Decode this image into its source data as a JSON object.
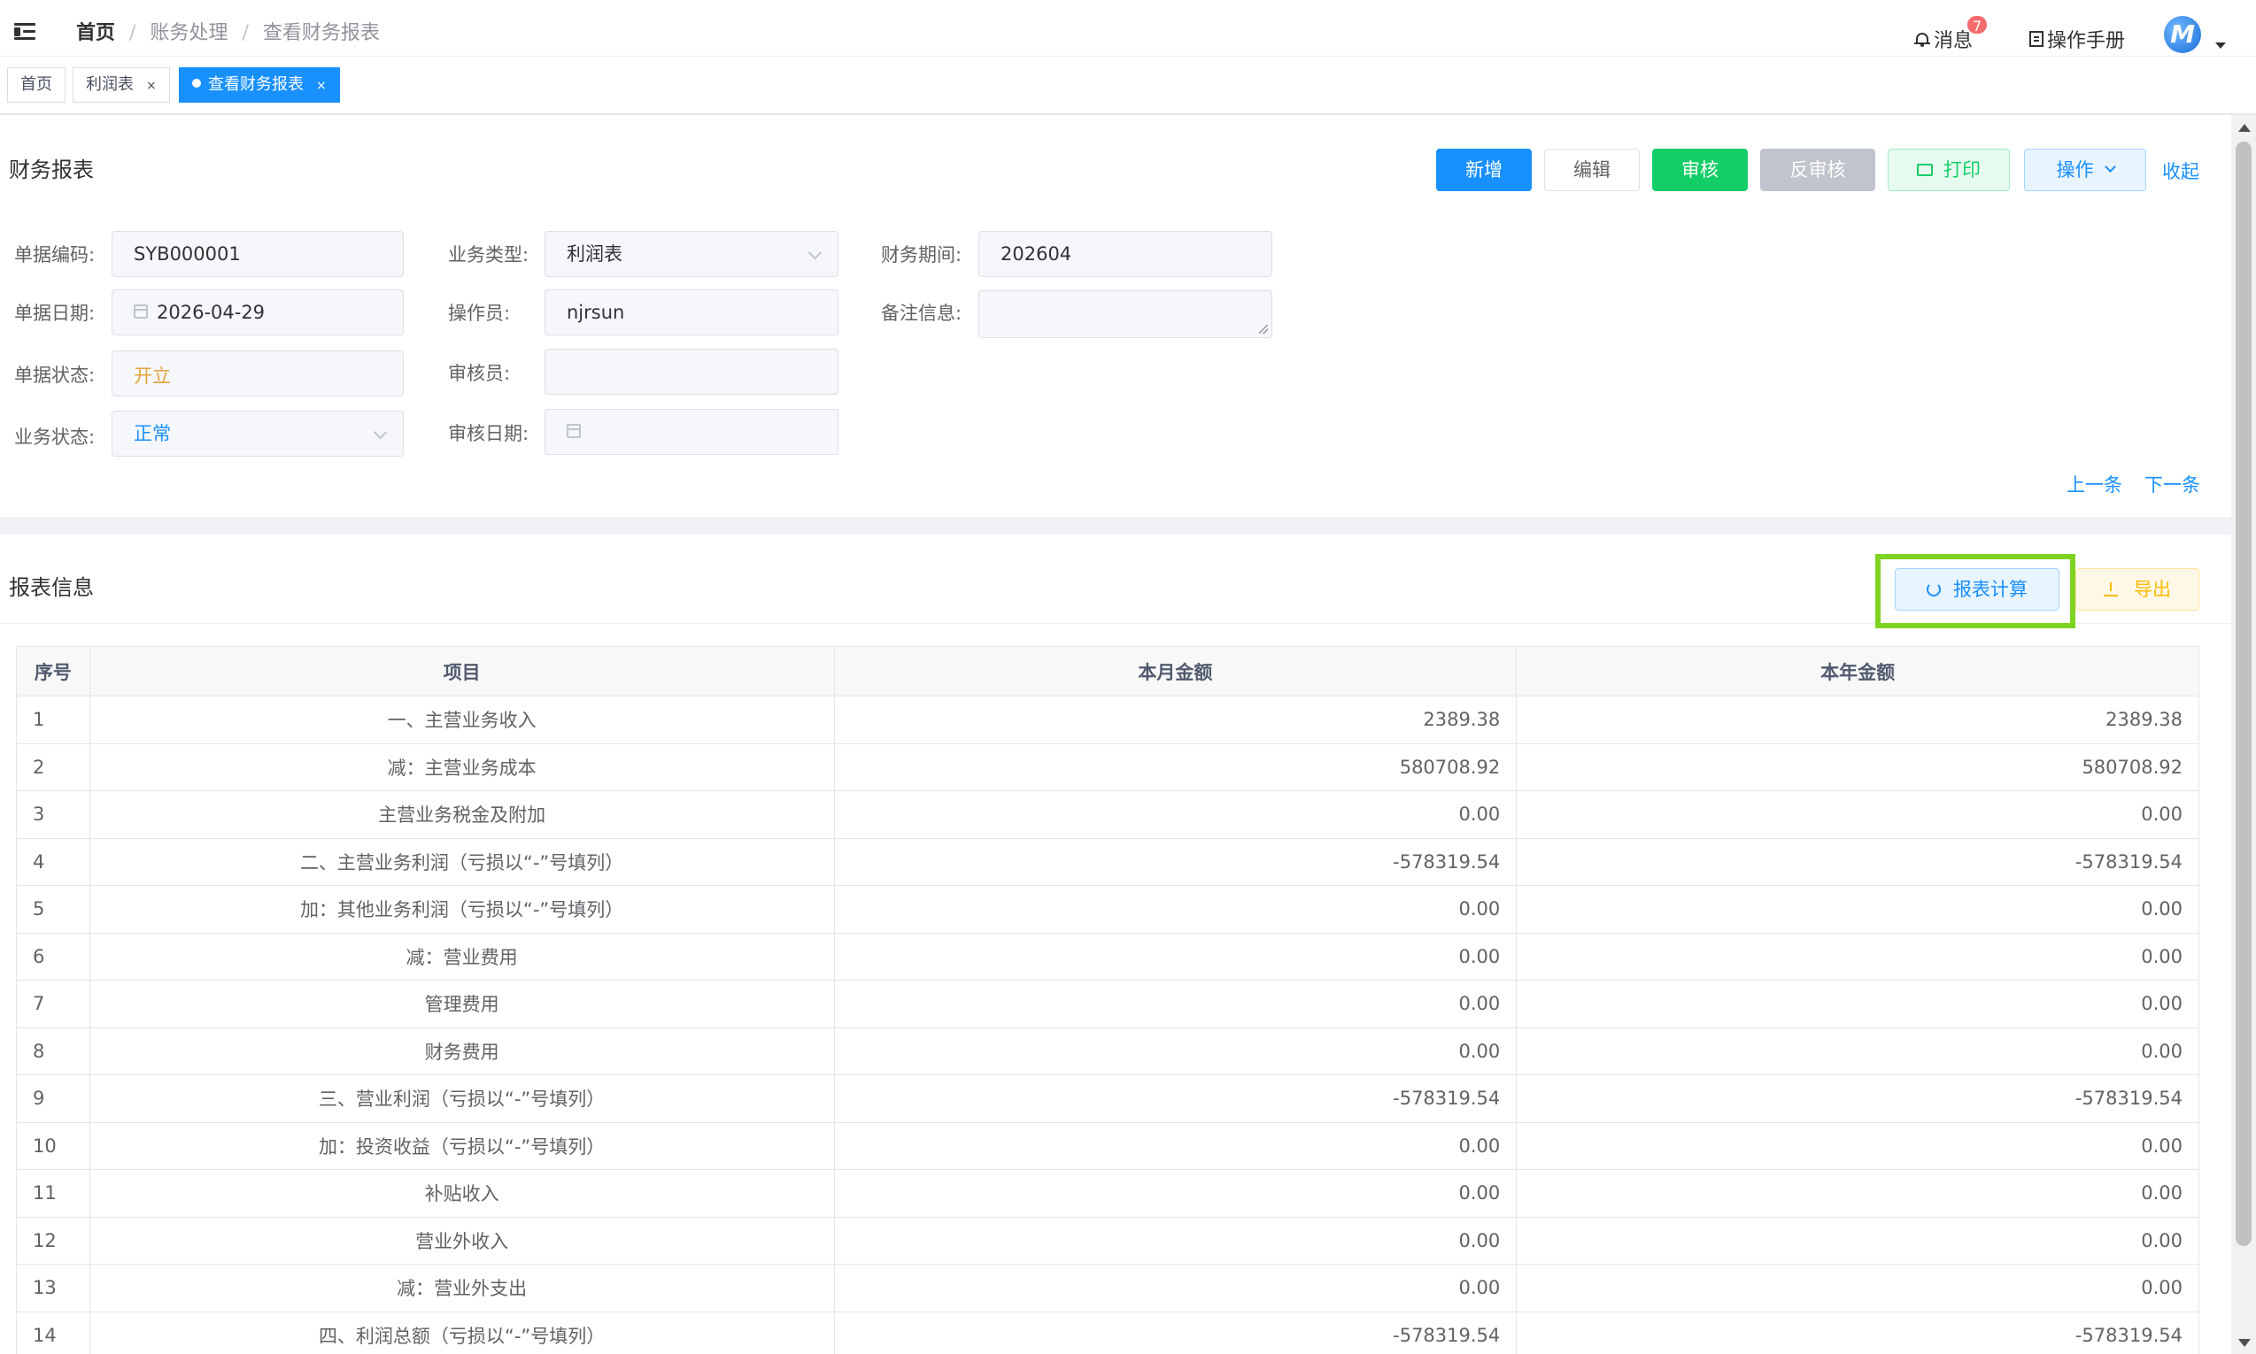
{
  "header": {
    "breadcrumb": [
      "首页",
      "账务处理",
      "查看财务报表"
    ],
    "breadcrumb_sep": "/",
    "messages_label": "消息",
    "messages_count": "7",
    "manual_label": "操作手册",
    "avatar_letter": "M"
  },
  "tags": [
    {
      "label": "首页",
      "close": ""
    },
    {
      "label": "利润表",
      "close": "×"
    },
    {
      "label": "查看财务报表",
      "close": "×"
    }
  ],
  "doc": {
    "title": "财务报表",
    "buttons": {
      "add": "新增",
      "edit": "编辑",
      "approve": "审核",
      "unapprove": "反审核",
      "print": "打印",
      "ops": "操作",
      "collapse": "收起"
    },
    "fields": {
      "bill_no": {
        "label": "单据编码:",
        "value": "SYB000001"
      },
      "biz_type": {
        "label": "业务类型:",
        "value": "利润表"
      },
      "period": {
        "label": "财务期间:",
        "value": "202604"
      },
      "bill_date": {
        "label": "单据日期:",
        "value": "2026-04-29"
      },
      "operator": {
        "label": "操作员:",
        "value": "njrsun"
      },
      "remark": {
        "label": "备注信息:",
        "value": ""
      },
      "bill_status": {
        "label": "单据状态:",
        "value": "开立"
      },
      "auditor": {
        "label": "审核员:",
        "value": ""
      },
      "biz_status": {
        "label": "业务状态:",
        "value": "正常"
      },
      "audit_date": {
        "label": "审核日期:",
        "value": ""
      }
    },
    "prev": "上一条",
    "next": "下一条"
  },
  "report": {
    "title": "报表信息",
    "calc_button": "报表计算",
    "export_button": "导出",
    "columns": [
      "序号",
      "项目",
      "本月金额",
      "本年金额"
    ],
    "rows": [
      {
        "seq": "1",
        "item": "一、主营业务收入",
        "month": "2389.38",
        "year": "2389.38"
      },
      {
        "seq": "2",
        "item": "减：主营业务成本",
        "month": "580708.92",
        "year": "580708.92"
      },
      {
        "seq": "3",
        "item": "主营业务税金及附加",
        "month": "0.00",
        "year": "0.00"
      },
      {
        "seq": "4",
        "item": "二、主营业务利润（亏损以“-”号填列）",
        "month": "-578319.54",
        "year": "-578319.54"
      },
      {
        "seq": "5",
        "item": "加：其他业务利润（亏损以“-”号填列）",
        "month": "0.00",
        "year": "0.00"
      },
      {
        "seq": "6",
        "item": "减：营业费用",
        "month": "0.00",
        "year": "0.00"
      },
      {
        "seq": "7",
        "item": "管理费用",
        "month": "0.00",
        "year": "0.00"
      },
      {
        "seq": "8",
        "item": "财务费用",
        "month": "0.00",
        "year": "0.00"
      },
      {
        "seq": "9",
        "item": "三、营业利润（亏损以“-”号填列）",
        "month": "-578319.54",
        "year": "-578319.54"
      },
      {
        "seq": "10",
        "item": "加：投资收益（亏损以“-”号填列）",
        "month": "0.00",
        "year": "0.00"
      },
      {
        "seq": "11",
        "item": "补贴收入",
        "month": "0.00",
        "year": "0.00"
      },
      {
        "seq": "12",
        "item": "营业外收入",
        "month": "0.00",
        "year": "0.00"
      },
      {
        "seq": "13",
        "item": "减：营业外支出",
        "month": "0.00",
        "year": "0.00"
      },
      {
        "seq": "14",
        "item": "四、利润总额（亏损以“-”号填列）",
        "month": "-578319.54",
        "year": "-578319.54"
      }
    ]
  },
  "colors": {
    "primary": "#1890ff",
    "success": "#13ce66",
    "warning": "#ffba00",
    "danger": "#f56c6c",
    "status_open": "#e6a23c",
    "highlight": "#7ed321"
  }
}
